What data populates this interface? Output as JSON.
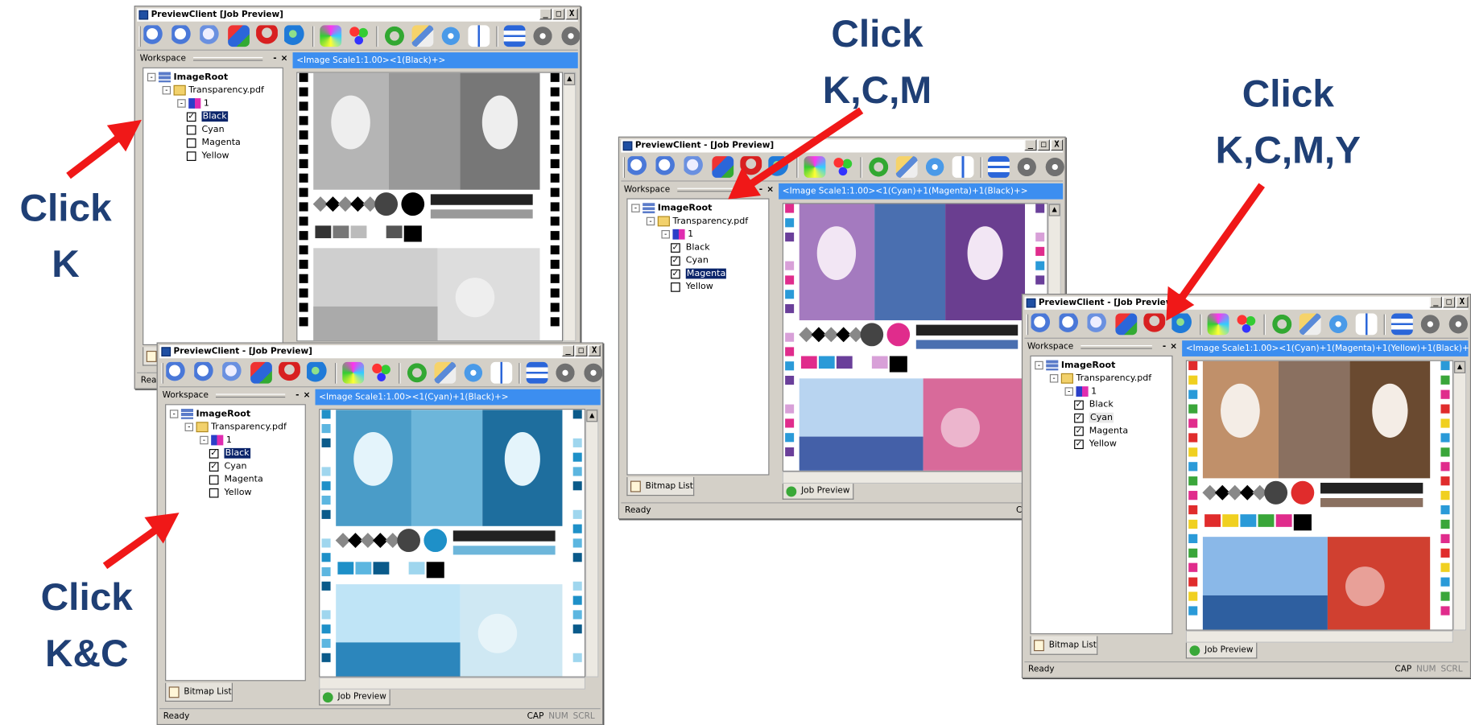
{
  "window_title_1": "PreviewClient   [Job Preview]",
  "window_title": "PreviewClient - [Job Preview]",
  "titlebar_buttons": {
    "minimize": "_",
    "maximize": "□",
    "close": "X"
  },
  "toolbar_icons": [
    "zoom-in-icon",
    "zoom-out-icon",
    "zoom-fit-icon",
    "monitor-icon",
    "magnet-icon",
    "globe-icon",
    "palette-icon",
    "color-separation-icon",
    "refresh-icon",
    "edit-icon",
    "disc-icon",
    "side-by-side-icon",
    "stack-icon",
    "previous-icon",
    "next-icon"
  ],
  "workspace": {
    "title": "Workspace",
    "pin": "-",
    "close": "×"
  },
  "tree": {
    "collapse": "-",
    "root": "ImageRoot",
    "file": "Transparency.pdf",
    "page": "1",
    "check_mark": "✓",
    "separations": [
      "Black",
      "Cyan",
      "Magenta",
      "Yellow"
    ]
  },
  "bitmap_tab": "Bitmap List",
  "job_tab": "Job Preview",
  "status": {
    "ready": "Ready",
    "cap": "CAP",
    "num": "NUM",
    "scrl": "SCRL"
  },
  "windows": [
    {
      "caption": "<Image Scale1:1.00><1(Black)+>",
      "checked": [
        "Black"
      ],
      "selected": "Black",
      "mode": "gray"
    },
    {
      "caption": "<Image Scale1:1.00><1(Cyan)+1(Black)+>",
      "checked": [
        "Black",
        "Cyan"
      ],
      "selected": "Black",
      "mode": "cyan"
    },
    {
      "caption": "<Image Scale1:1.00><1(Cyan)+1(Magenta)+1(Black)+>",
      "checked": [
        "Black",
        "Cyan",
        "Magenta"
      ],
      "selected": "Magenta",
      "mode": "cmk"
    },
    {
      "caption": "<Image Scale1:1.00><1(Cyan)+1(Magenta)+1(Yellow)+1(Black)+>",
      "checked": [
        "Black",
        "Cyan",
        "Magenta",
        "Yellow"
      ],
      "selected": "Cyan",
      "mode": "cmyk"
    }
  ],
  "callouts": {
    "k": [
      "Click",
      "K"
    ],
    "kc": [
      "Click",
      "K&C"
    ],
    "kcm": [
      "Click",
      "K,C,M"
    ],
    "kcmy": [
      "Click",
      "K,C,M,Y"
    ]
  },
  "arrow_color": "#f01818",
  "callout_color": "#1f3f75",
  "caption_bar_color": "#3c8ef0"
}
